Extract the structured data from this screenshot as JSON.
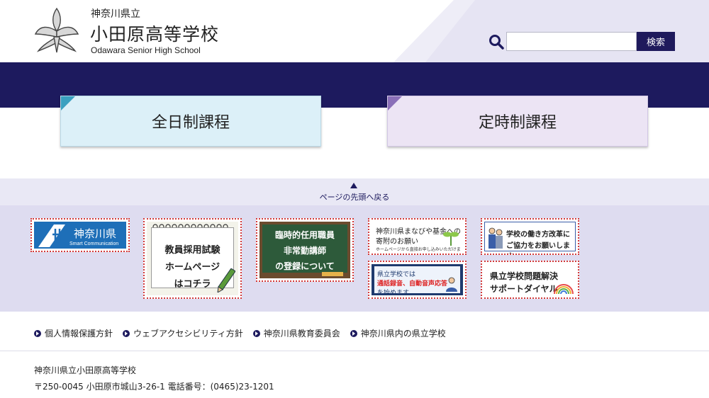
{
  "header": {
    "prefecture_label": "神奈川県立",
    "school_name": "小田原高等学校",
    "school_name_en": "Odawara Senior High School",
    "search": {
      "placeholder": "",
      "value": "",
      "button_label": "検索"
    }
  },
  "courses": {
    "full_time": "全日制課程",
    "part_time": "定時制課程"
  },
  "page_top": {
    "label": "ページの先頭へ戻る"
  },
  "banners": {
    "kanagawa": {
      "title": "神奈川県",
      "subtitle": "Smart Communication"
    },
    "teacher_recruit": {
      "line1": "教員採用試験",
      "line2": "ホームページ",
      "line3": "はコチラ"
    },
    "temporary_staff": {
      "line1": "臨時的任用職員",
      "line2": "非常勤講師",
      "line3": "の登録について"
    },
    "manabiya_fund": {
      "line1": "神奈川県まなびや基金への",
      "line2": "寄附のお願い",
      "line3": "ホームページから直接お申し込みいただけます！"
    },
    "call_recording": {
      "line1": "県立学校では",
      "line2": "通話録音、自動音声応答",
      "line3": "を始めます"
    },
    "work_reform": {
      "line1": "学校の働き方改革に",
      "line2": "ご協力をお願いします"
    },
    "support_dial": {
      "line1": "県立学校問題解決",
      "line2": "サポートダイヤル"
    }
  },
  "footer": {
    "links": [
      "個人情報保護方針",
      "ウェブアクセシビリティ方針",
      "神奈川県教育委員会",
      "神奈川県内の県立学校"
    ],
    "address_name": "神奈川県立小田原高等学校",
    "address_line": "〒250-0045 小田原市城山3-26-1 電話番号：(0465)23-1201"
  },
  "colors": {
    "navy": "#1d1a5e",
    "full_time_bg": "#dcf0f8",
    "part_time_bg": "#ece4f4",
    "banner_area_bg": "#dedcf0"
  }
}
